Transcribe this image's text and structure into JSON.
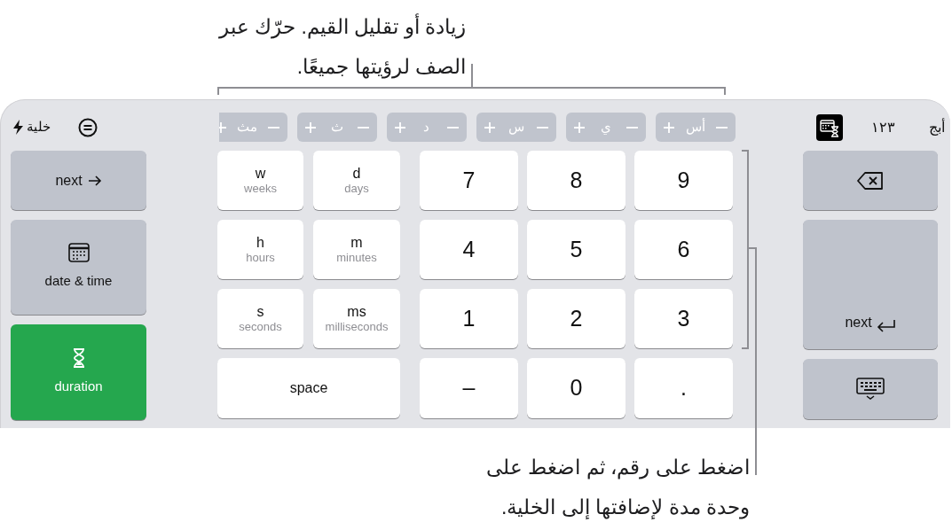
{
  "callouts": [
    {
      "text": "زيادة أو تقليل القيم. حرّك عبر الصف لرؤيتها جميعًا."
    },
    {
      "text": "اضغط على رقم، ثم اضغط على وحدة مدة لإضافتها إلى الخلية."
    }
  ],
  "toolbar": {
    "cell_button": "خلية",
    "steppers": [
      {
        "label": "أس"
      },
      {
        "label": "ي"
      },
      {
        "label": "س"
      },
      {
        "label": "د"
      },
      {
        "label": "ث"
      },
      {
        "label": "مث"
      }
    ],
    "modes": [
      {
        "kind": "text",
        "label": "أبج",
        "selected": false
      },
      {
        "kind": "text",
        "label": "١٢٣",
        "selected": false
      },
      {
        "kind": "icon",
        "selected": true
      }
    ]
  },
  "left_keys": [
    {
      "kind": "next",
      "label": "next"
    },
    {
      "kind": "date",
      "label": "date & time",
      "selected": false
    },
    {
      "kind": "duration",
      "label": "duration",
      "selected": true
    }
  ],
  "unit_keys": [
    {
      "label": "d",
      "sub": "days"
    },
    {
      "label": "w",
      "sub": "weeks"
    },
    {
      "label": "m",
      "sub": "minutes"
    },
    {
      "label": "h",
      "sub": "hours"
    },
    {
      "label": "ms",
      "sub": "milliseconds"
    },
    {
      "label": "s",
      "sub": "seconds"
    }
  ],
  "space_key": "space",
  "digit_keys": [
    "9",
    "8",
    "7",
    "6",
    "5",
    "4",
    "3",
    "2",
    "1",
    ".",
    "0",
    "–"
  ],
  "right_keys": [
    {
      "kind": "delete"
    },
    {
      "kind": "return",
      "label": "next"
    },
    {
      "kind": "hide"
    }
  ]
}
